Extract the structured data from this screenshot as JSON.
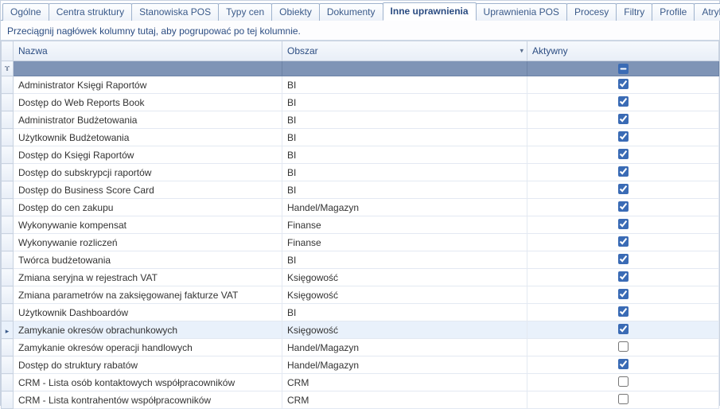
{
  "tabs": [
    {
      "label": "Ogólne",
      "active": false
    },
    {
      "label": "Centra struktury",
      "active": false
    },
    {
      "label": "Stanowiska POS",
      "active": false
    },
    {
      "label": "Typy cen",
      "active": false
    },
    {
      "label": "Obiekty",
      "active": false
    },
    {
      "label": "Dokumenty",
      "active": false
    },
    {
      "label": "Inne uprawnienia",
      "active": true
    },
    {
      "label": "Uprawnienia POS",
      "active": false
    },
    {
      "label": "Procesy",
      "active": false
    },
    {
      "label": "Filtry",
      "active": false
    },
    {
      "label": "Profile",
      "active": false
    },
    {
      "label": "Atrybuty",
      "active": false
    }
  ],
  "group_panel_text": "Przeciągnij nagłówek kolumny tutaj, aby pogrupować po tej kolumnie.",
  "columns": {
    "name": "Nazwa",
    "area": "Obszar",
    "active": "Aktywny"
  },
  "filter_row": {
    "indicator": "ɤ",
    "active_state": "indeterminate"
  },
  "rows": [
    {
      "name": "Administrator Księgi Raportów",
      "area": "BI",
      "active": true,
      "selected": false
    },
    {
      "name": "Dostęp do Web Reports Book",
      "area": "BI",
      "active": true,
      "selected": false
    },
    {
      "name": "Administrator Budżetowania",
      "area": "BI",
      "active": true,
      "selected": false
    },
    {
      "name": "Użytkownik Budżetowania",
      "area": "BI",
      "active": true,
      "selected": false
    },
    {
      "name": "Dostęp do Księgi Raportów",
      "area": "BI",
      "active": true,
      "selected": false
    },
    {
      "name": "Dostęp do subskrypcji raportów",
      "area": "BI",
      "active": true,
      "selected": false
    },
    {
      "name": "Dostęp do Business Score Card",
      "area": "BI",
      "active": true,
      "selected": false
    },
    {
      "name": "Dostęp do cen zakupu",
      "area": "Handel/Magazyn",
      "active": true,
      "selected": false
    },
    {
      "name": "Wykonywanie kompensat",
      "area": "Finanse",
      "active": true,
      "selected": false
    },
    {
      "name": "Wykonywanie rozliczeń",
      "area": "Finanse",
      "active": true,
      "selected": false
    },
    {
      "name": "Twórca budżetowania",
      "area": "BI",
      "active": true,
      "selected": false
    },
    {
      "name": "Zmiana seryjna w rejestrach VAT",
      "area": "Księgowość",
      "active": true,
      "selected": false
    },
    {
      "name": "Zmiana parametrów na zaksięgowanej fakturze VAT",
      "area": "Księgowość",
      "active": true,
      "selected": false
    },
    {
      "name": "Użytkownik Dashboardów",
      "area": "BI",
      "active": true,
      "selected": false
    },
    {
      "name": "Zamykanie okresów obrachunkowych",
      "area": "Księgowość",
      "active": true,
      "selected": true
    },
    {
      "name": "Zamykanie okresów operacji handlowych",
      "area": "Handel/Magazyn",
      "active": false,
      "selected": false
    },
    {
      "name": "Dostęp do struktury rabatów",
      "area": "Handel/Magazyn",
      "active": true,
      "selected": false
    },
    {
      "name": "CRM - Lista osób kontaktowych współpracowników",
      "area": "CRM",
      "active": false,
      "selected": false
    },
    {
      "name": "CRM - Lista kontrahentów współpracowników",
      "area": "CRM",
      "active": false,
      "selected": false
    }
  ]
}
